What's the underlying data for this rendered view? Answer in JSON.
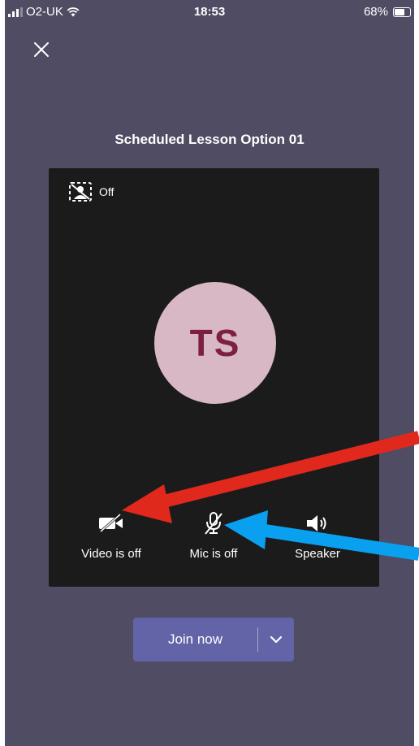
{
  "status_bar": {
    "carrier": "O2-UK",
    "time": "18:53",
    "battery": "68%",
    "battery_level": 0.68
  },
  "meeting": {
    "title": "Scheduled Lesson Option 01"
  },
  "preview": {
    "background_effects_label": "Off",
    "avatar_initials": "TS",
    "controls": {
      "video_label": "Video is off",
      "mic_label": "Mic is off",
      "speaker_label": "Speaker"
    }
  },
  "join": {
    "label": "Join now"
  },
  "annotations": {
    "arrow_1_color": "#e0291c",
    "arrow_2_color": "#0aa0f0"
  },
  "colors": {
    "background": "#4f4c63",
    "preview": "#1c1b1c",
    "avatar_bg": "#d7b8c4",
    "avatar_text": "#7c1f43",
    "join_button": "#6264a7"
  }
}
